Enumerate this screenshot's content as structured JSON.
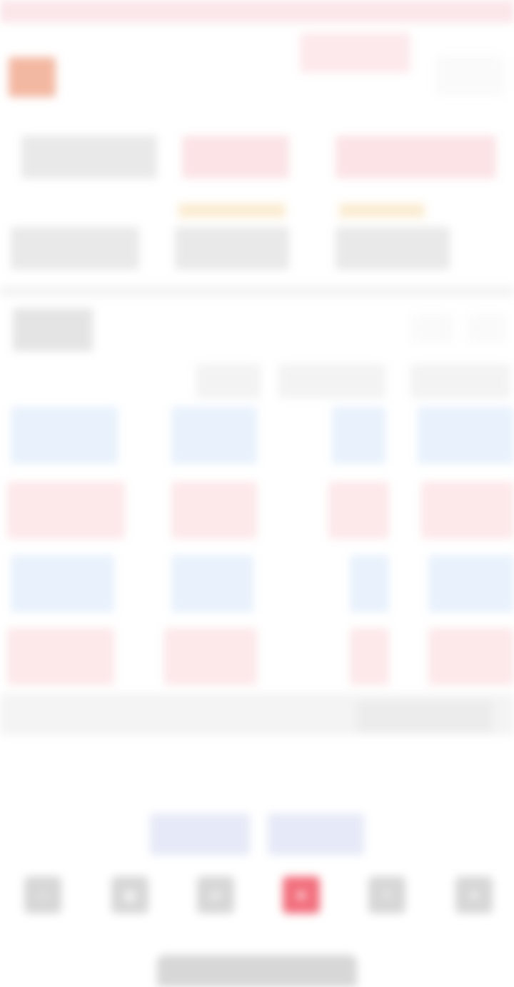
{
  "top_tabs": [
    {
      "label": "",
      "sub": ""
    },
    {
      "label": "",
      "sub": ""
    },
    {
      "label": "",
      "sub": ""
    },
    {
      "label": "",
      "sub": ""
    },
    {
      "label": "",
      "sub": ""
    }
  ],
  "active_tab_index": 3,
  "header": {
    "title": "",
    "right_action": ""
  },
  "quote": {
    "row1": [
      {
        "label": "",
        "value": "",
        "color": "#555555"
      },
      {
        "label": "",
        "value": "",
        "color": "#e0525f"
      },
      {
        "label": "",
        "value": "",
        "color": "#e0525f"
      }
    ],
    "row2": [
      {
        "label": "",
        "value": "",
        "color": "#555555"
      },
      {
        "label": "",
        "value": "",
        "color": "#555555",
        "accent": "#e9a23b"
      },
      {
        "label": "",
        "value": "",
        "color": "#555555",
        "accent": "#e9a23b"
      }
    ]
  },
  "panel": {
    "title": "",
    "right_actions": [
      "",
      ""
    ]
  },
  "table": {
    "headers": [
      "",
      "",
      "",
      ""
    ],
    "rows": [
      {
        "style": "blue",
        "cells": [
          "",
          "",
          "",
          ""
        ],
        "subs": [
          "",
          "",
          "",
          ""
        ]
      },
      {
        "style": "red",
        "cells": [
          "",
          "",
          "",
          ""
        ],
        "subs": [
          "",
          "",
          "",
          ""
        ]
      },
      {
        "style": "blue",
        "cells": [
          "",
          "",
          "",
          ""
        ],
        "subs": [
          "",
          "",
          "",
          ""
        ]
      },
      {
        "style": "red",
        "cells": [
          "",
          "",
          "",
          ""
        ],
        "subs": [
          "",
          "",
          "",
          ""
        ]
      }
    ]
  },
  "more_button": "",
  "stats": [
    {
      "label": "",
      "value": ""
    },
    {
      "label": "",
      "value": ""
    },
    {
      "label": "",
      "value": ""
    },
    {
      "label": "",
      "value": ""
    }
  ],
  "pills": [
    "",
    ""
  ],
  "bottom_nav": [
    {
      "label": "",
      "icon": "home-icon"
    },
    {
      "label": "",
      "icon": "quotes-icon"
    },
    {
      "label": "",
      "icon": "trade-icon"
    },
    {
      "label": "",
      "icon": "hot-icon",
      "active": true
    },
    {
      "label": "",
      "icon": "info-icon"
    },
    {
      "label": "",
      "icon": "user-icon"
    }
  ],
  "colors": {
    "accent_red": "#e35b6a",
    "up_red": "#e0525f",
    "down_blue": "#3f80d6",
    "highlight_orange": "#e9a23b",
    "row_blue_bg": "#e8f1fc",
    "row_red_bg": "#fde8ea"
  }
}
